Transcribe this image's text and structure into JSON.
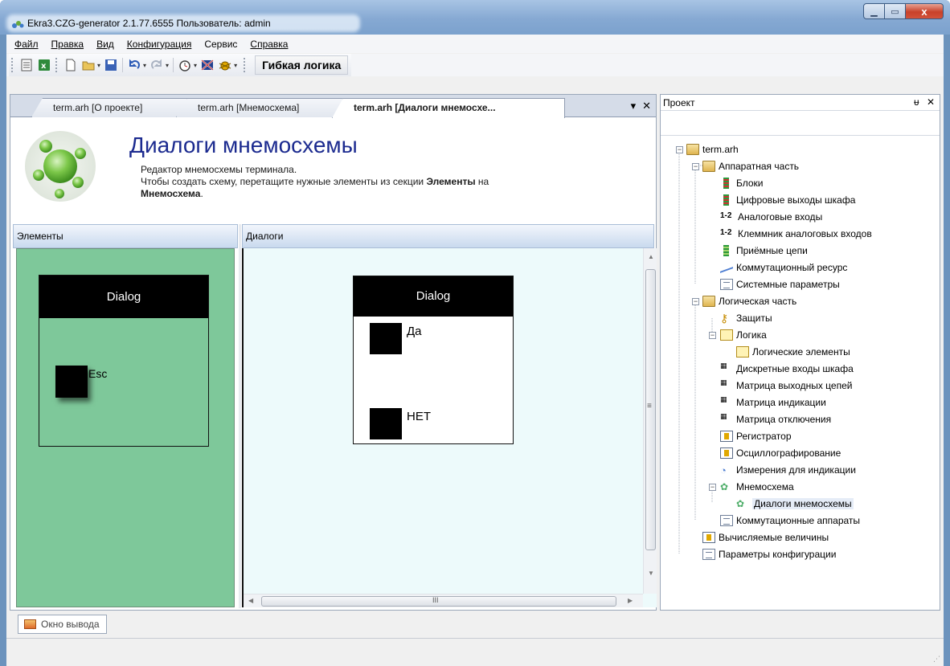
{
  "window": {
    "title": "Ekra3.CZG-generator 2.1.77.6555 Пользователь: admin",
    "close_glyph": "x"
  },
  "menu": [
    {
      "label": "Файл"
    },
    {
      "label": "Правка"
    },
    {
      "label": "Вид"
    },
    {
      "label": "Конфигурация"
    },
    {
      "label": "Сервис"
    },
    {
      "label": "Справка"
    }
  ],
  "toolbar": {
    "mode_label": "Гибкая логика",
    "icons": [
      "list-icon",
      "excel-icon",
      "new-icon",
      "open-icon",
      "save-icon",
      "undo-icon",
      "redo-icon",
      "timer-icon",
      "flag-icon",
      "bug-icon"
    ]
  },
  "tabs": [
    {
      "label": "term.arh [О проекте]"
    },
    {
      "label": "term.arh [Мнемосхема]"
    },
    {
      "label": "term.arh [Диалоги мнемосхе..."
    }
  ],
  "tab_controls": {
    "dropdown": "▾",
    "close": "✕"
  },
  "header": {
    "title": "Диалоги мнемосхемы",
    "desc_line1": "Редактор мнемосхемы терминала.",
    "desc_line2_pre": "Чтобы создать схему, перетащите нужные элементы из секции ",
    "desc_line2_bold": "Элементы",
    "desc_line2_post": " на",
    "desc_line3_bold": "Мнемосхема",
    "desc_line3_post": "."
  },
  "panes": {
    "elements_label": "Элементы",
    "dialogs_label": "Диалоги"
  },
  "elements_dialog": {
    "title": "Dialog",
    "button_label": "Esc"
  },
  "canvas_dialog": {
    "title": "Dialog",
    "yes_label": "Да",
    "no_label": "НЕТ"
  },
  "scroll": {
    "grip": "≡",
    "hgrip": "III"
  },
  "project": {
    "title": "Проект",
    "pin": "ᵾ",
    "close": "✕",
    "tree": [
      {
        "label": "term.arh"
      },
      {
        "label": "Аппаратная часть"
      },
      {
        "label": "Блоки"
      },
      {
        "label": "Цифровые выходы шкафа"
      },
      {
        "label": "Аналоговые входы"
      },
      {
        "label": "Клеммник аналоговых входов"
      },
      {
        "label": "Приёмные цепи"
      },
      {
        "label": "Коммутационный ресурс"
      },
      {
        "label": "Системные параметры"
      },
      {
        "label": "Логическая часть"
      },
      {
        "label": "Защиты"
      },
      {
        "label": "Логика"
      },
      {
        "label": "Логические элементы"
      },
      {
        "label": "Дискретные входы шкафа"
      },
      {
        "label": "Матрица выходных цепей"
      },
      {
        "label": "Матрица индикации"
      },
      {
        "label": "Матрица отключения"
      },
      {
        "label": "Регистратор"
      },
      {
        "label": "Осциллографирование"
      },
      {
        "label": "Измерения для индикации"
      },
      {
        "label": "Мнемосхема"
      },
      {
        "label": "Диалоги мнемосхемы"
      },
      {
        "label": "Коммутационные аппараты"
      },
      {
        "label": "Вычисляемые величины"
      },
      {
        "label": "Параметры конфигурации"
      }
    ],
    "analog_glyph": "1-2"
  },
  "output": {
    "label": "Окно вывода"
  },
  "colors": {
    "elements_bg": "#7ec89a",
    "canvas_bg": "#edfafb",
    "title_blue": "#1b2a8f"
  }
}
